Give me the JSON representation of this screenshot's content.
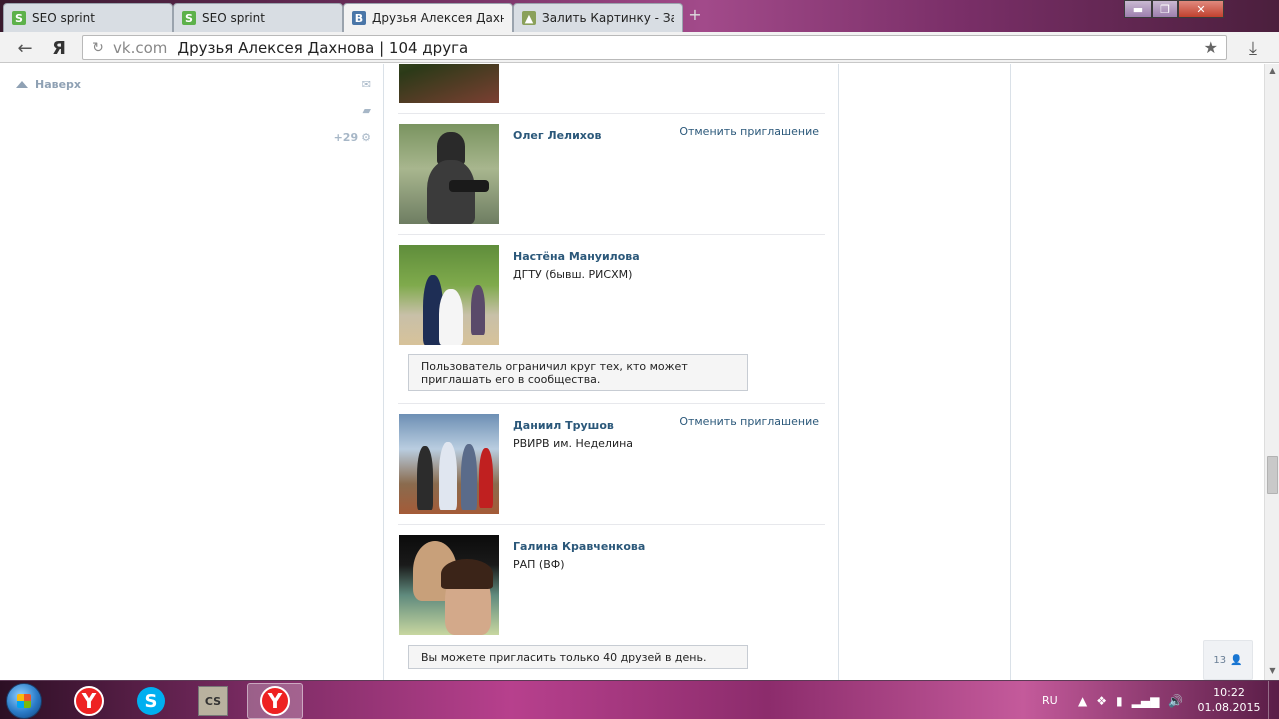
{
  "browser": {
    "tabs": [
      {
        "title": "SEO sprint",
        "icon": "seo-sprint-favicon",
        "active": false
      },
      {
        "title": "SEO sprint",
        "icon": "seo-sprint-favicon",
        "active": false
      },
      {
        "title": "Друзья Алексея Дахнова",
        "icon": "vk-favicon",
        "active": true
      },
      {
        "title": "Залить Картинку - Зал",
        "icon": "image-host-favicon",
        "active": false
      }
    ],
    "yandex_letter": "Я",
    "host": "vk.com",
    "page_title": "Друзья Алексея Дахнова | 104 друга"
  },
  "sidebar": {
    "up_label": "Наверх",
    "notifications_count": "+29"
  },
  "friends": [
    {
      "name": "",
      "subtitle": "",
      "cancel": ""
    },
    {
      "name": "Олег Лелихов",
      "subtitle": "",
      "cancel": "Отменить приглашение"
    },
    {
      "name": "Настёна Мануилова",
      "subtitle": "ДГТУ (бывш. РИСХМ)",
      "cancel": "",
      "notice": "Пользователь ограничил круг тех, кто может приглашать его в сообщества."
    },
    {
      "name": "Даниил Трушов",
      "subtitle": "РВИРВ им. Неделина",
      "cancel": "Отменить приглашение"
    },
    {
      "name": "Галина Кравченкова",
      "subtitle": "РАП (ВФ)",
      "cancel": "",
      "notice": "Вы можете пригласить только 40 друзей в день."
    }
  ],
  "online_counter": "13",
  "taskbar": {
    "apps": [
      "yandex-browser",
      "skype",
      "counter-strike",
      "yandex-browser-active"
    ],
    "language": "RU",
    "time": "10:22",
    "date": "01.08.2015"
  }
}
